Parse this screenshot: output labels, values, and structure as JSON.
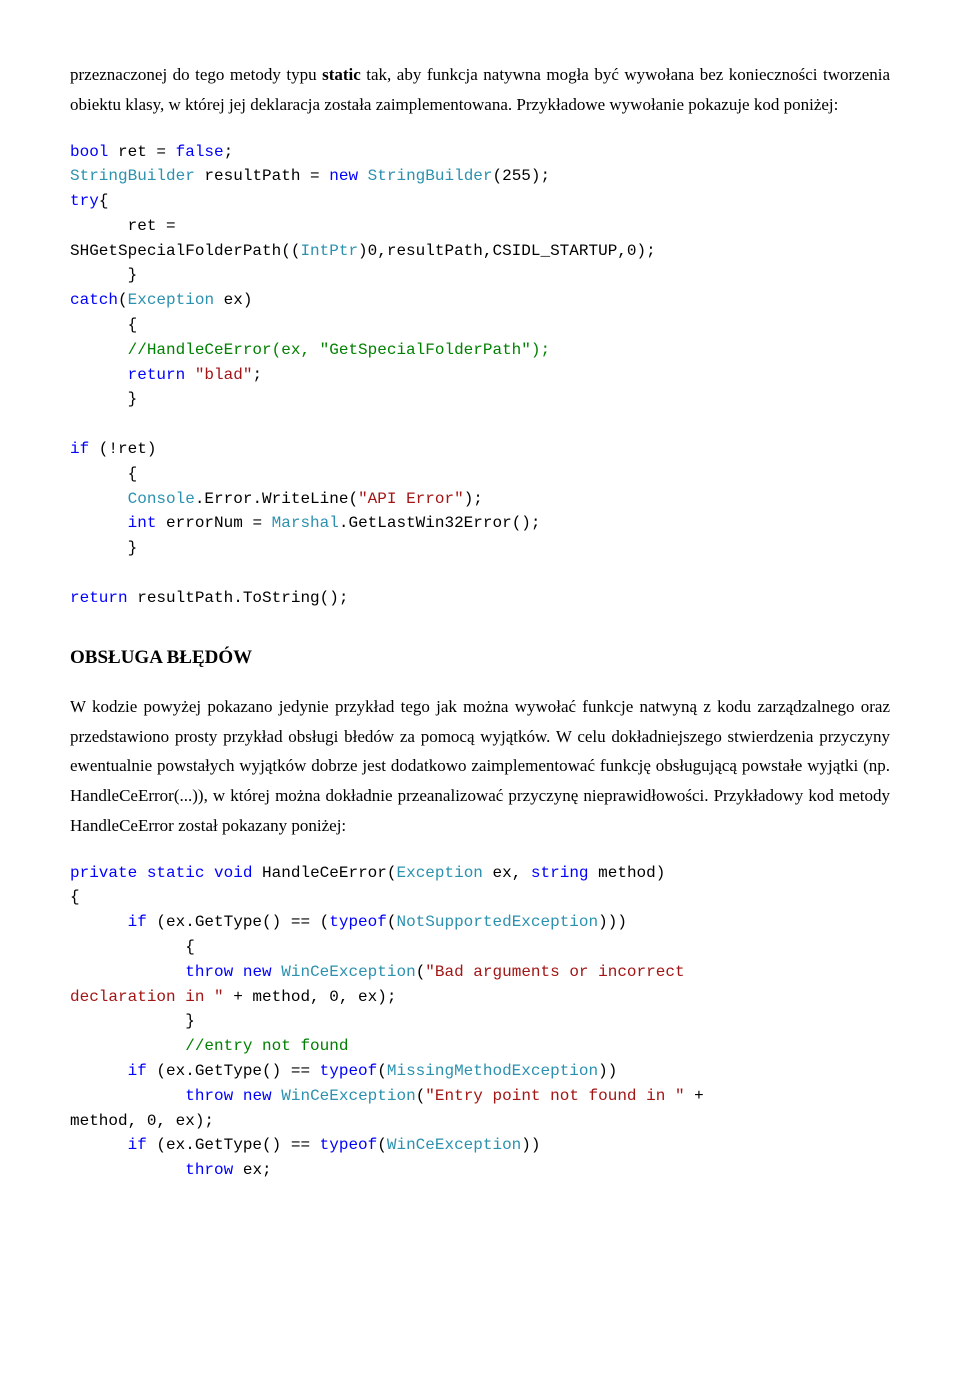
{
  "para1_pre": "przeznaczonej do tego metody typu ",
  "para1_bold": "static",
  "para1_post": " tak, aby funkcja natywna mogła być wywołana bez konieczności tworzenia obiektu klasy, w której jej deklaracja została zaimplementowana. Przykładowe wywołanie pokazuje kod poniżej:",
  "code1": {
    "l1a": "bool",
    "l1b": " ret = ",
    "l1c": "false",
    "l1d": ";",
    "l2a": "StringBuilder",
    "l2b": " resultPath = ",
    "l2c": "new",
    "l2d": " ",
    "l2e": "StringBuilder",
    "l2f": "(255);",
    "l3a": "try",
    "l3b": "{",
    "l4a": "      ret =",
    "l5a": "SHGetSpecialFolderPath((",
    "l5b": "IntPtr",
    "l5c": ")0,resultPath,CSIDL_STARTUP,0);",
    "l6a": "      }",
    "l7a": "catch",
    "l7b": "(",
    "l7c": "Exception",
    "l7d": " ex)",
    "l8a": "      {",
    "l9a": "      //HandleCeError(ex, \"GetSpecialFolderPath\");",
    "l10a": "      ",
    "l10b": "return",
    "l10c": " ",
    "l10d": "\"blad\"",
    "l10e": ";",
    "l11a": "      }",
    "blank1": "",
    "l12a": "if",
    "l12b": " (!ret)",
    "l13a": "      {",
    "l14a": "      ",
    "l14b": "Console",
    "l14c": ".Error.WriteLine(",
    "l14d": "\"API Error\"",
    "l14e": ");",
    "l15a": "      ",
    "l15b": "int",
    "l15c": " errorNum = ",
    "l15d": "Marshal",
    "l15e": ".GetLastWin32Error();",
    "l16a": "      }",
    "blank2": "",
    "l17a": "return",
    "l17b": " resultPath.ToString();"
  },
  "section_title": "OBSŁUGA BŁĘDÓW",
  "para2": "W kodzie powyżej pokazano jedynie przykład tego jak można wywołać funkcje natwyną z kodu zarządzalnego oraz przedstawiono prosty przykład obsługi błedów za pomocą wyjątków. W celu dokładniejszego stwierdzenia przyczyny ewentualnie powstałych wyjątków dobrze jest dodatkowo zaimplementować funkcję obsługującą powstałe wyjątki (np. HandleCeError(...)), w której można dokładnie przeanalizować przyczynę nieprawidłowości. Przykładowy kod metody HandleCeError został pokazany poniżej:",
  "code2": {
    "l1a": "private",
    "l1b": " ",
    "l1c": "static",
    "l1d": " ",
    "l1e": "void",
    "l1f": " HandleCeError(",
    "l1g": "Exception",
    "l1h": " ex, ",
    "l1i": "string",
    "l1j": " method)",
    "l2a": "{",
    "l3a": "      ",
    "l3b": "if",
    "l3c": " (ex.GetType() == (",
    "l3d": "typeof",
    "l3e": "(",
    "l3f": "NotSupportedException",
    "l3g": ")))",
    "l4a": "            {",
    "l5a": "            ",
    "l5b": "throw",
    "l5c": " ",
    "l5d": "new",
    "l5e": " ",
    "l5f": "WinCeException",
    "l5g": "(",
    "l5h": "\"Bad arguments or incorrect",
    "l6a": "declaration in \"",
    "l6b": " + method, 0, ex);",
    "l7a": "            }",
    "l8a": "            //entry not found",
    "l9a": "      ",
    "l9b": "if",
    "l9c": " (ex.GetType() == ",
    "l9d": "typeof",
    "l9e": "(",
    "l9f": "MissingMethodException",
    "l9g": "))",
    "l10a": "            ",
    "l10b": "throw",
    "l10c": " ",
    "l10d": "new",
    "l10e": " ",
    "l10f": "WinCeException",
    "l10g": "(",
    "l10h": "\"Entry point not found in \"",
    "l10i": " +",
    "l11a": "method, 0, ex);",
    "l12a": "      ",
    "l12b": "if",
    "l12c": " (ex.GetType() == ",
    "l12d": "typeof",
    "l12e": "(",
    "l12f": "WinCeException",
    "l12g": "))",
    "l13a": "            ",
    "l13b": "throw",
    "l13c": " ex;"
  }
}
